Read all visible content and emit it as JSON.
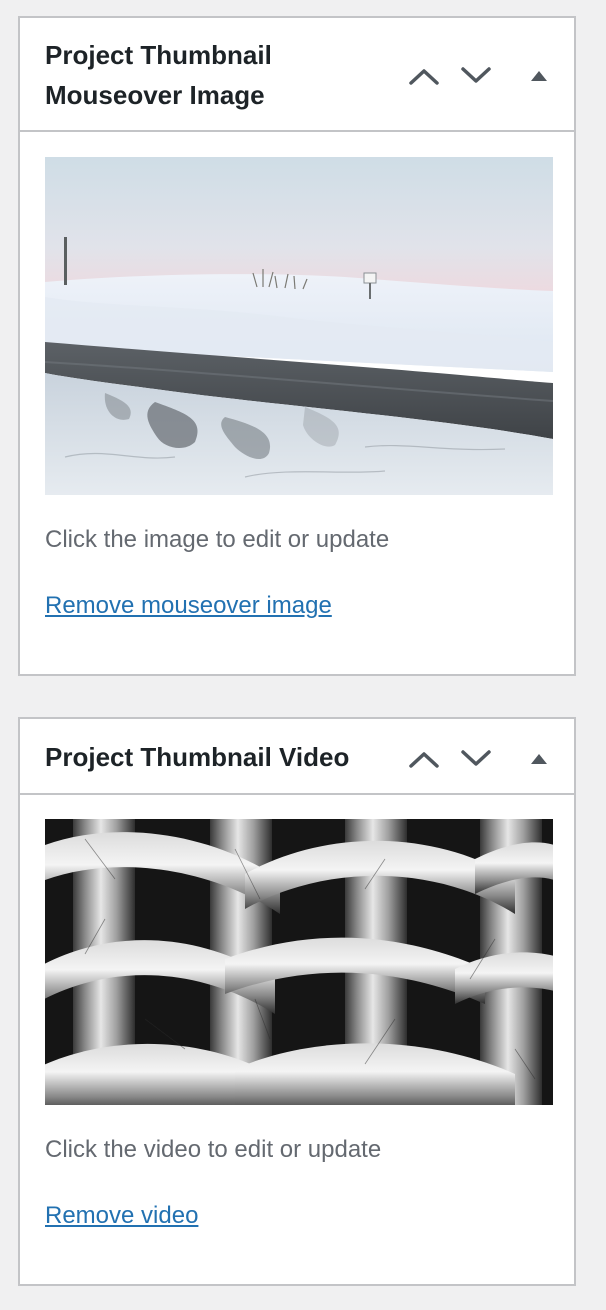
{
  "mouseover_box": {
    "title": "Project Thumbnail Mouseover Image",
    "move_up_icon": "chevron-up-icon",
    "move_down_icon": "chevron-down-icon",
    "toggle_icon": "triangle-up-icon",
    "image_alt": "Snowy roadside landscape under pale sky",
    "hint": "Click the image to edit or update",
    "remove_link": "Remove mouseover image"
  },
  "video_box": {
    "title": "Project Thumbnail Video",
    "move_up_icon": "chevron-up-icon",
    "move_down_icon": "chevron-down-icon",
    "toggle_icon": "triangle-up-icon",
    "video_alt": "Woven brushed-metal ribbons",
    "hint": "Click the video to edit or update",
    "remove_link": "Remove video"
  },
  "colors": {
    "background": "#f0f0f1",
    "panel": "#ffffff",
    "border": "#c3c4c7",
    "heading": "#1d2327",
    "muted_text": "#646970",
    "link": "#2271b1",
    "icon": "#50575e"
  }
}
